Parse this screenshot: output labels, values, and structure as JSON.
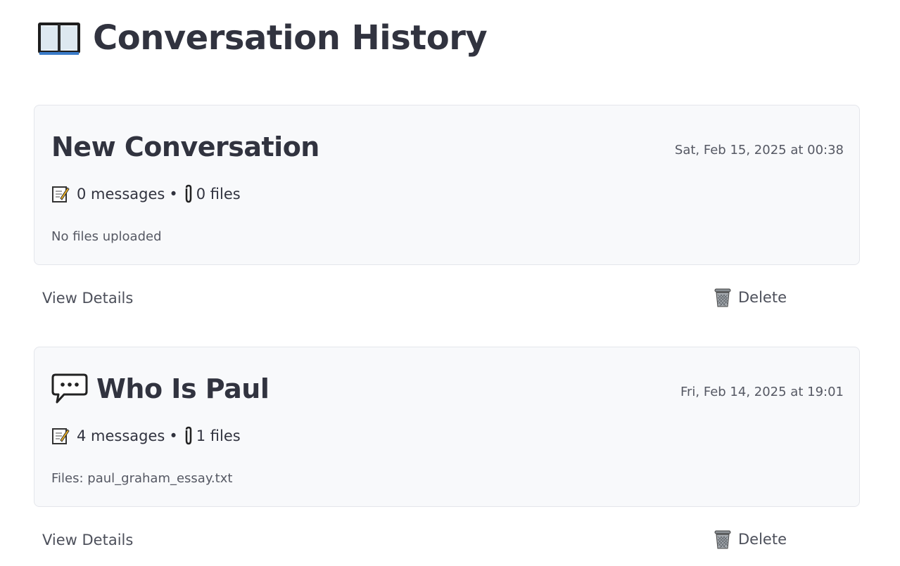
{
  "page": {
    "title": "Conversation History",
    "title_icon": "open-book-icon"
  },
  "conversations": [
    {
      "title": "New Conversation",
      "has_chat_icon": false,
      "date": "Sat, Feb 15, 2025 at 00:38",
      "messages_label": "0 messages",
      "separator": "•",
      "files_label": "0 files",
      "files_detail": "No files uploaded",
      "view_details_label": "View Details",
      "delete_label": "Delete"
    },
    {
      "title": "Who Is Paul",
      "has_chat_icon": true,
      "date": "Fri, Feb 14, 2025 at 19:01",
      "messages_label": "4 messages",
      "separator": "•",
      "files_label": "1 files",
      "files_detail": "Files: paul_graham_essay.txt",
      "view_details_label": "View Details",
      "delete_label": "Delete"
    }
  ],
  "icons": {
    "memo": "memo-icon",
    "paperclip": "paperclip-icon",
    "trash": "wastebasket-icon",
    "chat": "speech-bubble-icon"
  },
  "colors": {
    "text": "#31333f",
    "muted": "#555863",
    "card_bg": "#f8f9fb",
    "card_border": "#e4e6eb"
  }
}
